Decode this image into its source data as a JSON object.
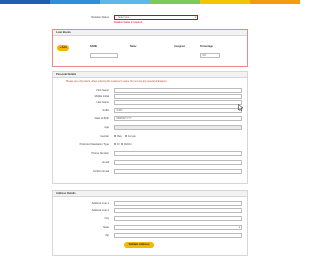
{
  "topbar": {
    "colors": [
      "#1f5fb0",
      "#2f8fd8",
      "#5bb8e8",
      "#7ccb5a",
      "#f5c400",
      "#f39c12"
    ]
  },
  "top": {
    "relation_label": "Relation Status",
    "relation_value": "- Select one -",
    "relation_error": "Relation Status is required."
  },
  "loan_books": {
    "title": "Loan Books",
    "add_button": "+ Add",
    "columns": [
      "NAME",
      "Name",
      "Assigned",
      "Percentage"
    ],
    "row_percentage": "0%"
  },
  "personal": {
    "title": "Personal Details",
    "notice": "Please use only letters, when entering the customer's name. Do not use any special characters.",
    "fields": {
      "first_name": "First Name",
      "middle_initial": "Middle Initial",
      "last_name": "Last Name",
      "suffix": "Suffix",
      "suffix_value": "Suffix",
      "date_of_birth": "Date of Birth",
      "dob_placeholder": "MM/DD/YYYY",
      "age": "Age",
      "gender": "Gender",
      "gender_options": [
        "Male",
        "Female"
      ],
      "preferred_salutation": "Preferred Salutation Type",
      "salutation_options": [
        "Mr",
        "Ms/Mrs"
      ],
      "phone": "Phone Number",
      "email": "Email",
      "confirm_email": "Confirm Email"
    }
  },
  "address": {
    "title": "Address Details",
    "fields": {
      "line1": "Address Line 1",
      "line2": "Address Line 2",
      "city": "City",
      "state": "State",
      "zip": "Zip"
    },
    "validate_button": "Validate Address"
  }
}
